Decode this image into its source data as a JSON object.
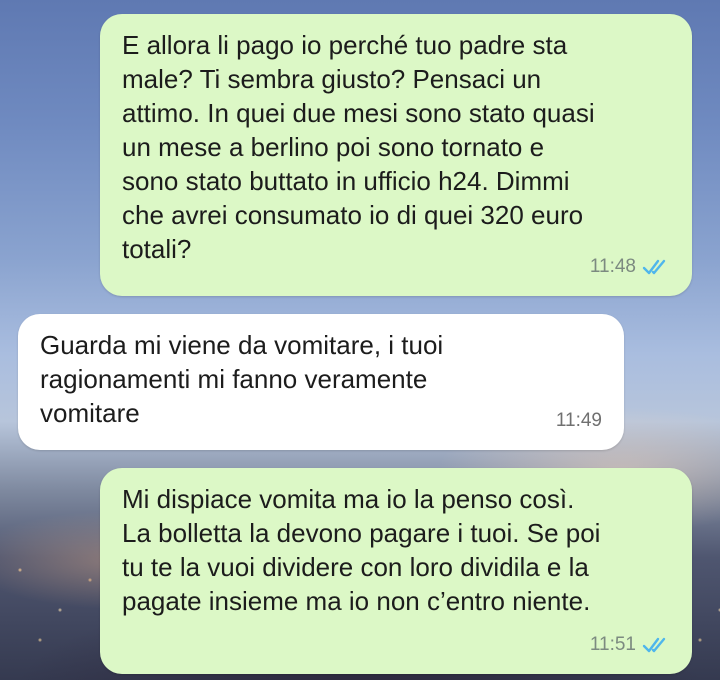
{
  "messages": [
    {
      "direction": "outgoing",
      "text": "E allora li pago io perché tuo padre sta\nmale? Ti sembra giusto? Pensaci un\nattimo. In quei due mesi sono stato quasi\nun mese a berlino poi sono tornato e\nsono stato buttato in ufficio h24. Dimmi\nche avrei consumato io di quei 320 euro\ntotali?",
      "time": "11:48",
      "status_icon": "double-check-read-icon"
    },
    {
      "direction": "incoming",
      "text": "Guarda mi viene da vomitare, i tuoi\nragionamenti mi fanno veramente\nvomitare",
      "time": "11:49"
    },
    {
      "direction": "outgoing",
      "text": "Mi dispiace vomita ma io la penso così.\nLa bolletta la devono pagare i tuoi. Se poi\ntu te la vuoi dividere con loro dividila e la\npagate insieme ma io non c’entro niente.",
      "time": "11:51",
      "status_icon": "double-check-read-icon"
    }
  ],
  "colors": {
    "outgoing_bubble": "#dcf8c6",
    "incoming_bubble": "#ffffff",
    "read_ticks": "#4fb6ec"
  }
}
